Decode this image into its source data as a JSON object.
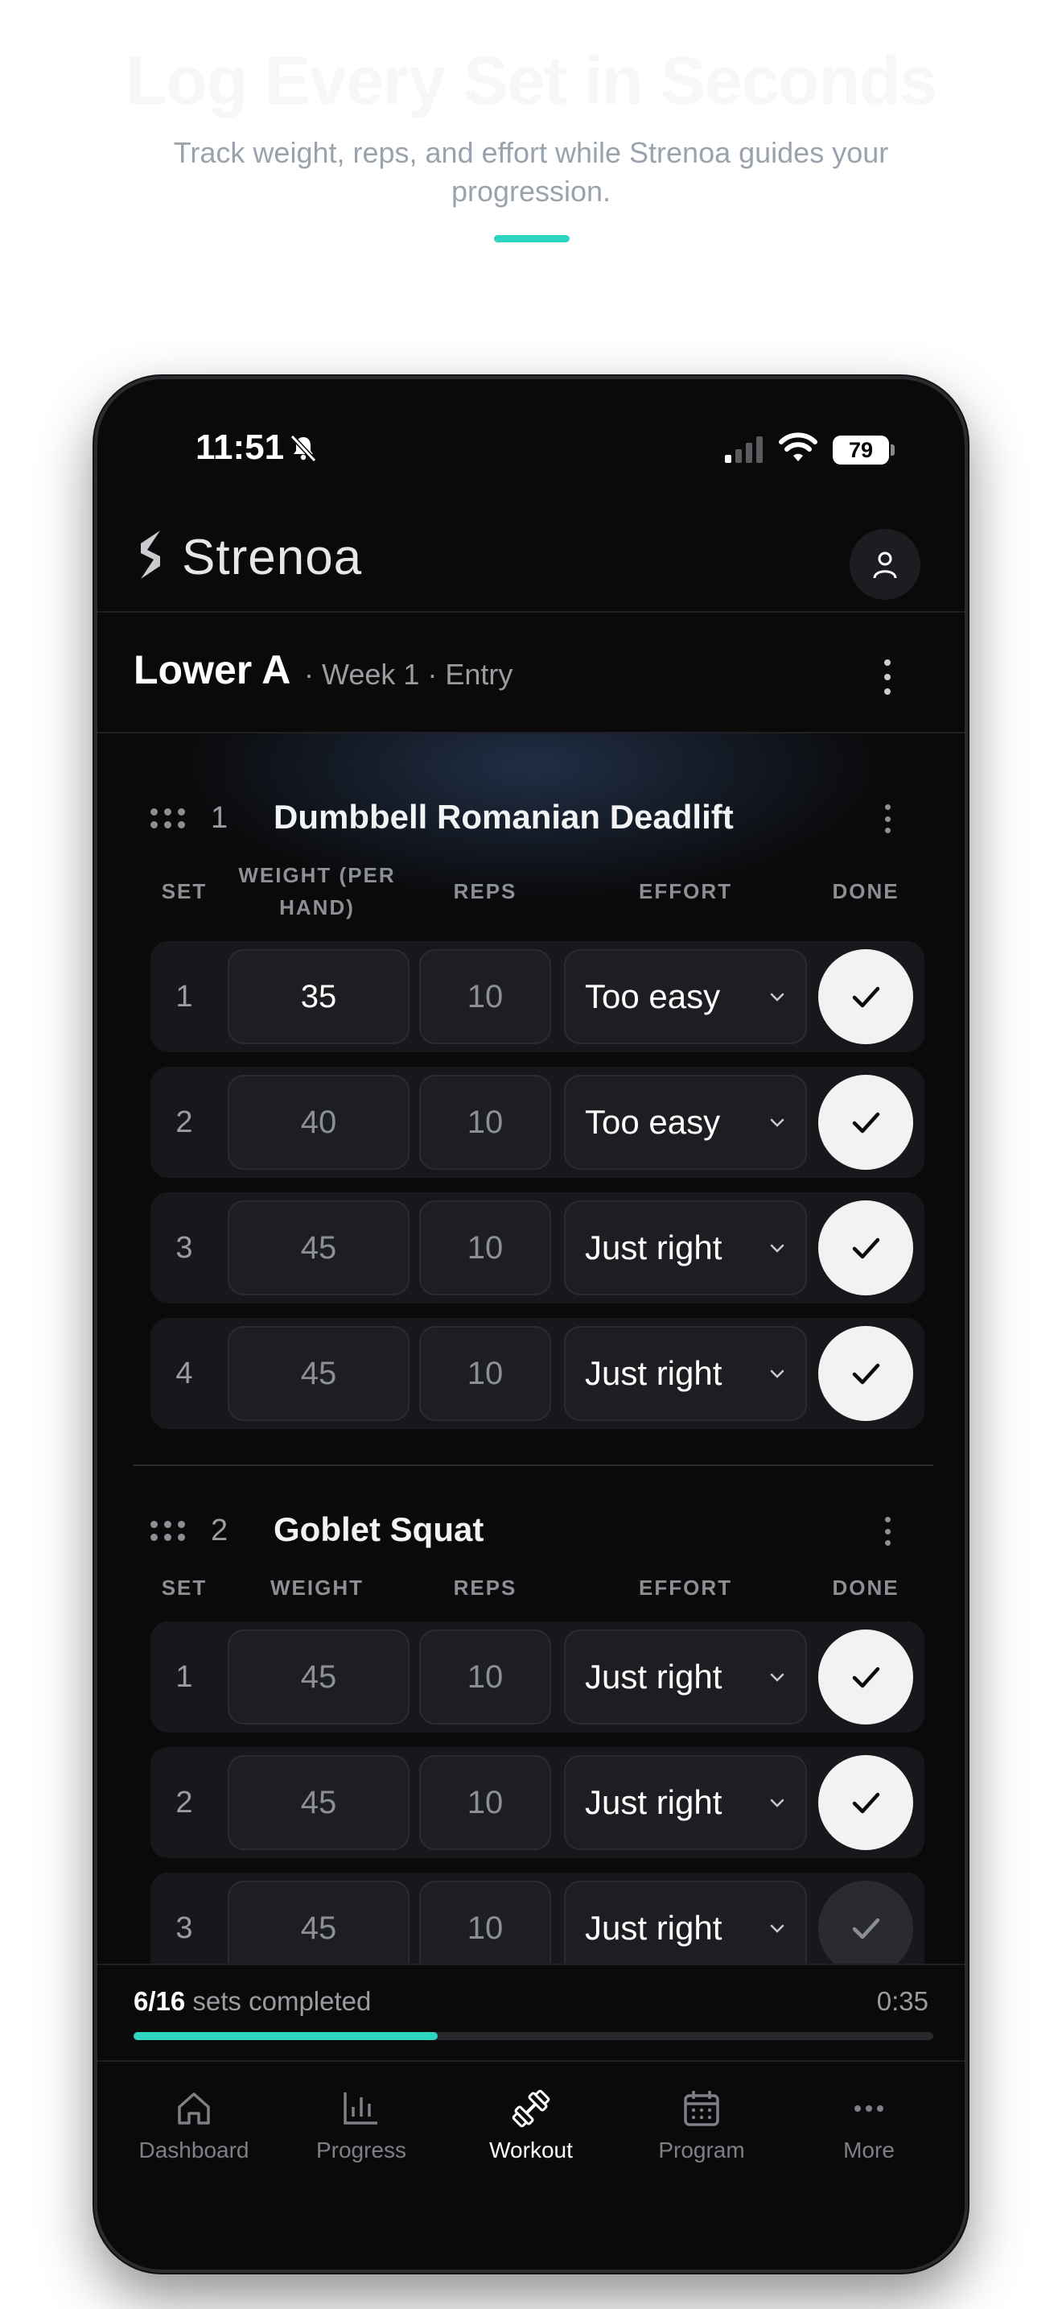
{
  "hero": {
    "title": "Log Every Set in Seconds",
    "subtitle": "Track weight, reps, and effort while Strenoa guides your progression."
  },
  "status_bar": {
    "time": "11:51",
    "battery": "79"
  },
  "app": {
    "brand": "Strenoa"
  },
  "workout": {
    "title": "Lower A",
    "meta": "· Week 1 · Entry"
  },
  "exercises": [
    {
      "number": "1",
      "name": "Dumbbell Romanian Deadlift",
      "headers": {
        "set": "SET",
        "weight": "WEIGHT (PER HAND)",
        "reps": "REPS",
        "effort": "EFFORT",
        "done": "DONE"
      },
      "sets": [
        {
          "set": "1",
          "weight": "35",
          "reps": "10",
          "effort": "Too easy",
          "done": true
        },
        {
          "set": "2",
          "weight": "40",
          "reps": "10",
          "effort": "Too easy",
          "done": true
        },
        {
          "set": "3",
          "weight": "45",
          "reps": "10",
          "effort": "Just right",
          "done": true
        },
        {
          "set": "4",
          "weight": "45",
          "reps": "10",
          "effort": "Just right",
          "done": true
        }
      ]
    },
    {
      "number": "2",
      "name": "Goblet Squat",
      "headers": {
        "set": "SET",
        "weight": "WEIGHT",
        "reps": "REPS",
        "effort": "EFFORT",
        "done": "DONE"
      },
      "sets": [
        {
          "set": "1",
          "weight": "45",
          "reps": "10",
          "effort": "Just right",
          "done": true
        },
        {
          "set": "2",
          "weight": "45",
          "reps": "10",
          "effort": "Just right",
          "done": true
        },
        {
          "set": "3",
          "weight": "45",
          "reps": "10",
          "effort": "Just right",
          "done": false
        }
      ]
    }
  ],
  "progress": {
    "count": "6/16",
    "label": "sets completed",
    "elapsed": "0:35",
    "fraction": 0.38
  },
  "nav": [
    {
      "label": "Dashboard",
      "icon": "home-icon",
      "active": false
    },
    {
      "label": "Progress",
      "icon": "chart-icon",
      "active": false
    },
    {
      "label": "Workout",
      "icon": "dumbbell-icon",
      "active": true
    },
    {
      "label": "Program",
      "icon": "calendar-icon",
      "active": false
    },
    {
      "label": "More",
      "icon": "more-icon",
      "active": false
    }
  ],
  "colors": {
    "accent": "#2dd4bf",
    "background": "#0a0a0b",
    "row": "#17181b"
  }
}
